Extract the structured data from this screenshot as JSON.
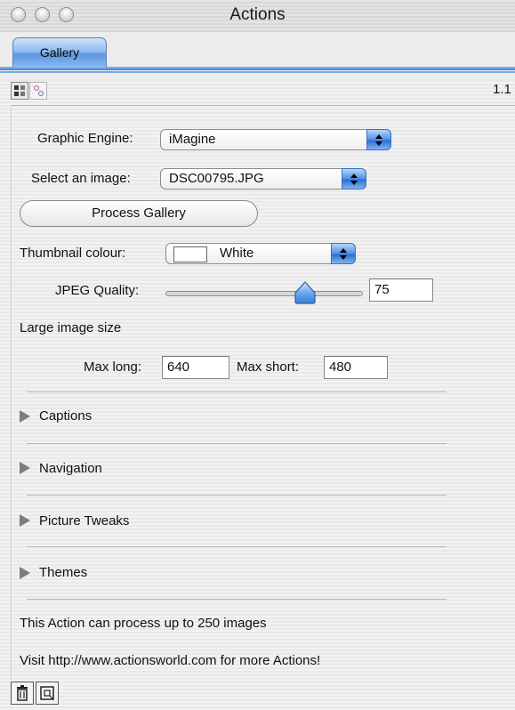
{
  "window": {
    "title": "Actions"
  },
  "tabs": [
    {
      "label": "Gallery",
      "selected": true
    }
  ],
  "toolbar": {
    "icons": [
      "layout-view-icon",
      "settings-view-icon"
    ],
    "version": "1.1"
  },
  "form": {
    "graphic_engine": {
      "label": "Graphic Engine:",
      "value": "iMagine"
    },
    "select_image": {
      "label": "Select an image:",
      "value": "DSC00795.JPG"
    },
    "process_button": "Process Gallery",
    "thumbnail_colour": {
      "label": "Thumbnail colour:",
      "value": "White",
      "swatch": "#ffffff"
    },
    "jpeg_quality": {
      "label": "JPEG Quality:",
      "value": "75",
      "slider_fraction": 0.72
    },
    "large_image": {
      "heading": "Large image size",
      "max_long_label": "Max long:",
      "max_long": "640",
      "max_short_label": "Max short:",
      "max_short": "480"
    }
  },
  "sections": [
    {
      "label": "Captions"
    },
    {
      "label": "Navigation"
    },
    {
      "label": "Picture Tweaks"
    },
    {
      "label": "Themes"
    }
  ],
  "footer": {
    "note1": "This Action can process up to 250 images",
    "note2": "Visit http://www.actionsworld.com for more Actions!"
  },
  "bottom_icons": [
    "trash-icon",
    "new-action-icon"
  ],
  "colors": {
    "accent": "#3f7fd4",
    "arrow_button": "#4f8fe4"
  }
}
